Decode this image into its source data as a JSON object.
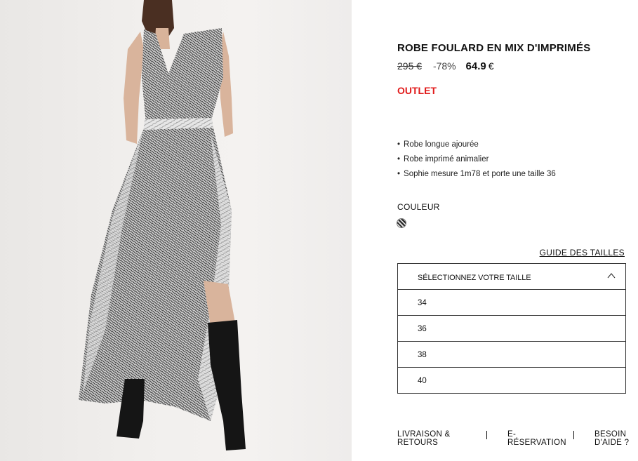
{
  "product": {
    "title": "ROBE FOULARD EN MIX D'IMPRIMÉS",
    "price_old": "295 €",
    "discount": "-78%",
    "price_new": "64.9",
    "currency": "€",
    "tag": "OUTLET",
    "tag_color": "#e11b1b",
    "bullets": [
      "Robe longue ajourée",
      "Robe imprimé animalier",
      "Sophie mesure 1m78 et porte une taille 36"
    ],
    "color_label": "COULEUR",
    "color_swatch_icon": "animal-print-swatch"
  },
  "size": {
    "guide_link": "GUIDE DES TAILLES",
    "select_label": "SÉLECTIONNEZ VOTRE TAILLE",
    "options": [
      "34",
      "36",
      "38",
      "40"
    ]
  },
  "footer": {
    "links": [
      {
        "line1": "LIVRAISON &",
        "line2": "RETOURS"
      },
      {
        "line1": "E-",
        "line2": "RÉSERVATION"
      },
      {
        "line1": "BESOIN",
        "line2": "D'AIDE ?"
      }
    ]
  }
}
